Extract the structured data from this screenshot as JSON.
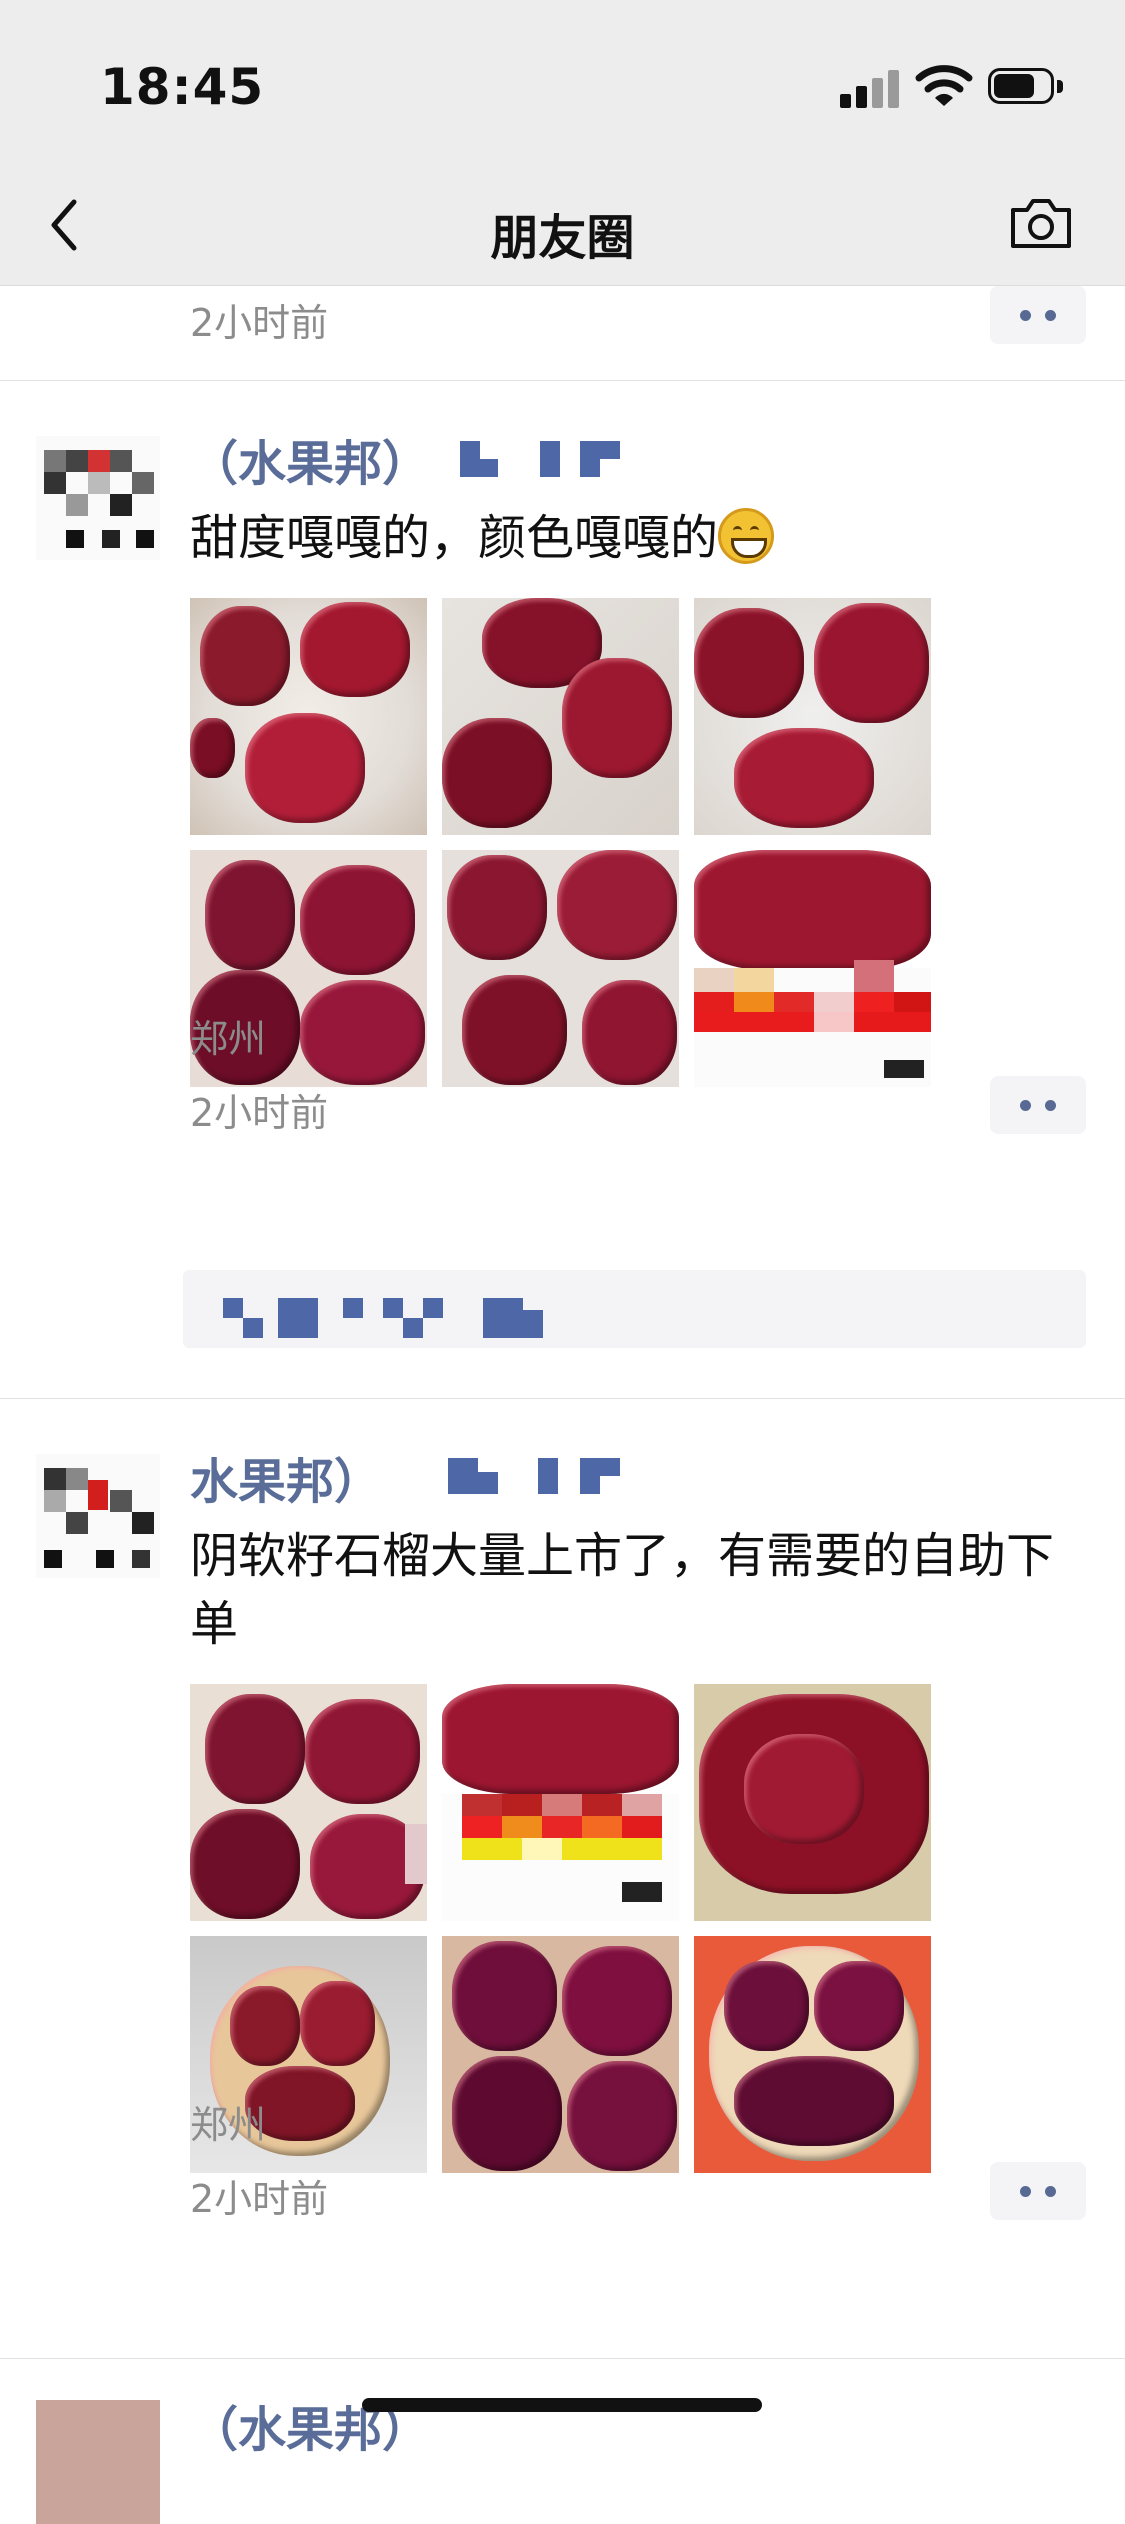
{
  "status_bar": {
    "time": "18:45",
    "icons": [
      "cellular-signal-icon",
      "wifi-icon",
      "battery-icon"
    ]
  },
  "navbar": {
    "title": "朋友圈",
    "back_icon": "chevron-left-icon",
    "camera_icon": "camera-icon"
  },
  "feed": {
    "top_partial": {
      "time": "2小时前"
    },
    "posts": [
      {
        "username": "（水果邦）",
        "text": "甜度嘎嘎的，颜色嘎嘎的",
        "emoji": "grinning-face-emoji",
        "photos": [
          "pomegranate-photo-1",
          "pomegranate-photo-2",
          "pomegranate-photo-3",
          "pomegranate-photo-4",
          "pomegranate-photo-5",
          "pomegranate-photo-6"
        ],
        "location": "郑州",
        "time": "2小时前"
      },
      {
        "username": "水果邦）",
        "text": "阴软籽石榴大量上市了，有需要的自助下单",
        "photos": [
          "pomegranate-photo-1",
          "pomegranate-photo-2",
          "pomegranate-photo-3",
          "pomegranate-photo-4",
          "pomegranate-photo-5",
          "pomegranate-photo-6"
        ],
        "location": "郑州",
        "time": "2小时前"
      },
      {
        "username": "（水果邦）"
      }
    ]
  },
  "colors": {
    "header_bg": "#ededed",
    "username": "#5a6d98",
    "meta_text": "#8c8c8c",
    "pomegranate_dark": "#7a0e24",
    "pomegranate_bright": "#b3193a"
  }
}
